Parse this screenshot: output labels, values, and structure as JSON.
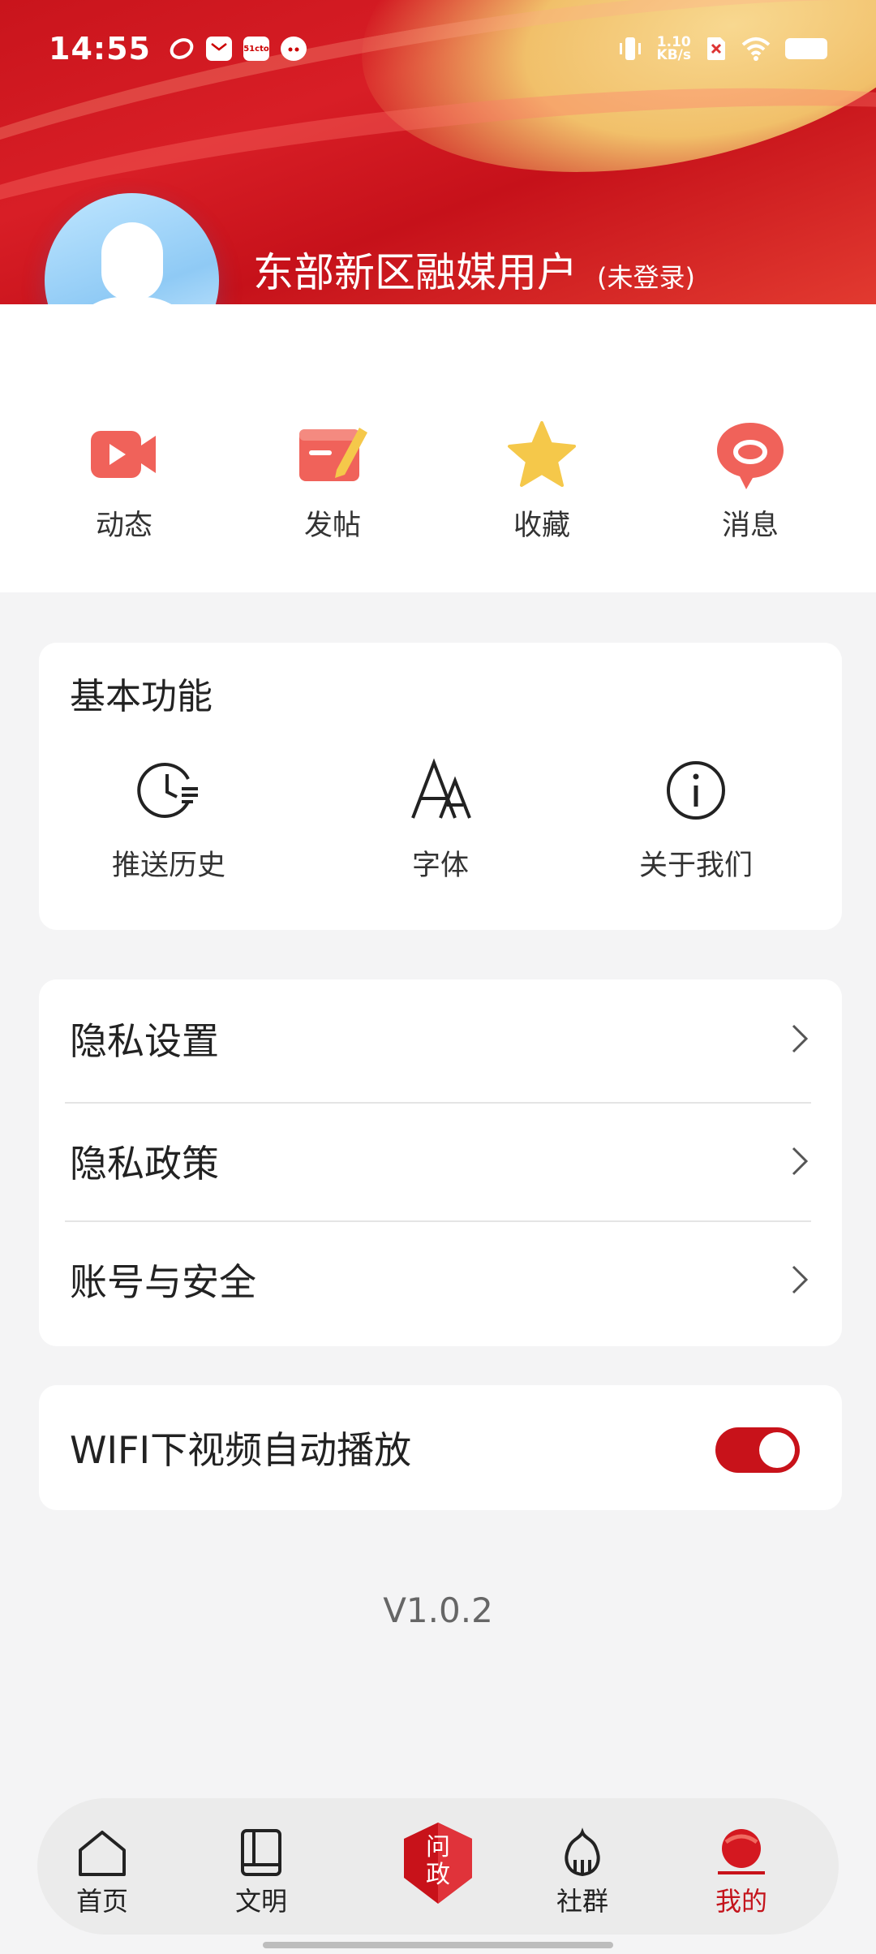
{
  "status_bar": {
    "time": "14:55",
    "notif_icons": [
      "app-icon-1",
      "mail-icon",
      "51cto-icon",
      "cat-icon"
    ],
    "notif_badge_text": "51cto",
    "net_speed_value": "1.10",
    "net_speed_unit": "KB/s"
  },
  "profile": {
    "username": "东部新区融媒用户",
    "login_note": "(未登录)"
  },
  "quick_actions": [
    {
      "label": "动态",
      "icon": "video-icon"
    },
    {
      "label": "发帖",
      "icon": "post-edit-icon"
    },
    {
      "label": "收藏",
      "icon": "star-icon"
    },
    {
      "label": "消息",
      "icon": "message-icon"
    }
  ],
  "basic_functions": {
    "title": "基本功能",
    "items": [
      {
        "label": "推送历史",
        "icon": "clock-list-icon"
      },
      {
        "label": "字体",
        "icon": "font-icon"
      },
      {
        "label": "关于我们",
        "icon": "info-icon"
      }
    ]
  },
  "settings_rows": [
    {
      "label": "隐私设置"
    },
    {
      "label": "隐私政策"
    },
    {
      "label": "账号与安全"
    }
  ],
  "wifi_autoplay": {
    "label": "WIFI下视频自动播放",
    "enabled": true
  },
  "version": "V1.0.2",
  "tabbar": {
    "items": [
      {
        "label": "首页",
        "icon": "home-icon",
        "active": false
      },
      {
        "label": "文明",
        "icon": "book-icon",
        "active": false
      },
      {
        "label": "问政",
        "icon": "ask-gov-icon",
        "active": false
      },
      {
        "label": "社群",
        "icon": "community-icon",
        "active": false
      },
      {
        "label": "我的",
        "icon": "profile-icon",
        "active": true
      }
    ]
  },
  "colors": {
    "brand_red": "#c8121a",
    "background": "#f4f4f5",
    "card": "#ffffff"
  }
}
